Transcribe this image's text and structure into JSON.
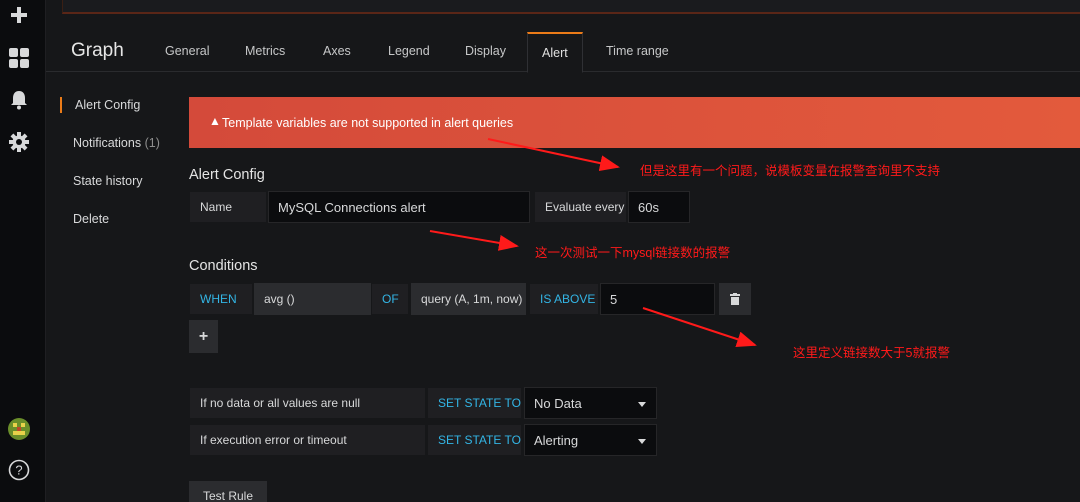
{
  "rail": {
    "icons": [
      "plus-icon",
      "dashboards-icon",
      "bell-icon",
      "gear-icon",
      "avatar",
      "help-icon"
    ],
    "help_glyph": "?"
  },
  "header": {
    "title": "Graph",
    "tabs": [
      {
        "label": "General"
      },
      {
        "label": "Metrics"
      },
      {
        "label": "Axes"
      },
      {
        "label": "Legend"
      },
      {
        "label": "Display"
      },
      {
        "label": "Alert",
        "active": true
      },
      {
        "label": "Time range"
      }
    ]
  },
  "side_menu": {
    "items": [
      {
        "label": "Alert Config",
        "active": true
      },
      {
        "label": "Notifications",
        "count": "(1)"
      },
      {
        "label": "State history"
      },
      {
        "label": "Delete"
      }
    ]
  },
  "banner": {
    "icon": "warning-icon",
    "glyph": "▲",
    "message": "Template variables are not supported in alert queries",
    "color": "#e0513b"
  },
  "alert_config": {
    "title": "Alert Config",
    "name_label": "Name",
    "name_value": "MySQL Connections alert",
    "evaluate_label": "Evaluate every",
    "evaluate_value": "60s"
  },
  "conditions": {
    "title": "Conditions",
    "when": "WHEN",
    "reducer": "avg ()",
    "of": "OF",
    "query": "query (A, 1m, now)",
    "evaluator": "IS ABOVE",
    "threshold": "5",
    "add_glyph": "+"
  },
  "no_data": {
    "label": "If no data or all values are null",
    "set_state": "SET STATE TO",
    "value": "No Data"
  },
  "exec_error": {
    "label": "If execution error or timeout",
    "set_state": "SET STATE TO",
    "value": "Alerting"
  },
  "test_rule": "Test Rule",
  "annotations": {
    "note1": "但是这里有一个问题，说模板变量在报警查询里不支持",
    "note2": "这一次测试一下mysql链接数的报警",
    "note3": "这里定义链接数大于5就报警",
    "color": "#ff1a1a"
  },
  "colors": {
    "accent": "#eb7b18",
    "keyword": "#33b5e5",
    "background": "#161719"
  }
}
